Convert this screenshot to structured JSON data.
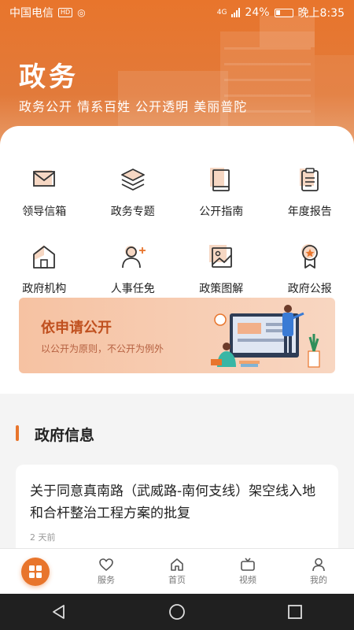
{
  "status_bar": {
    "carrier": "中国电信",
    "badge": "HD",
    "network": "4G",
    "battery": "24%",
    "time": "晚上8:35"
  },
  "header": {
    "title": "政务",
    "slogan": "政务公开 情系百姓 公开透明 美丽普陀"
  },
  "grid_items": [
    {
      "label": "领导信箱",
      "icon": "mail-icon"
    },
    {
      "label": "政务专题",
      "icon": "layers-icon"
    },
    {
      "label": "公开指南",
      "icon": "book-icon"
    },
    {
      "label": "年度报告",
      "icon": "clipboard-icon"
    },
    {
      "label": "政府机构",
      "icon": "building-icon"
    },
    {
      "label": "人事任免",
      "icon": "user-add-icon"
    },
    {
      "label": "政策图解",
      "icon": "image-icon"
    },
    {
      "label": "政府公报",
      "icon": "award-icon"
    }
  ],
  "banner": {
    "title": "依申请公开",
    "subtitle": "以公开为原则，不公开为例外"
  },
  "news_section": {
    "title": "政府信息",
    "items": [
      {
        "headline": "关于同意真南路（武威路-南何支线）架空线入地和合杆整治工程方案的批复",
        "time": "2 天前"
      }
    ]
  },
  "tab_bar": [
    {
      "label": "",
      "icon": "grid-icon",
      "active": true
    },
    {
      "label": "服务",
      "icon": "heart-icon"
    },
    {
      "label": "首页",
      "icon": "home-icon"
    },
    {
      "label": "视频",
      "icon": "tv-icon"
    },
    {
      "label": "我的",
      "icon": "person-icon"
    }
  ],
  "colors": {
    "accent": "#e8752c",
    "banner_title": "#c0501f"
  }
}
